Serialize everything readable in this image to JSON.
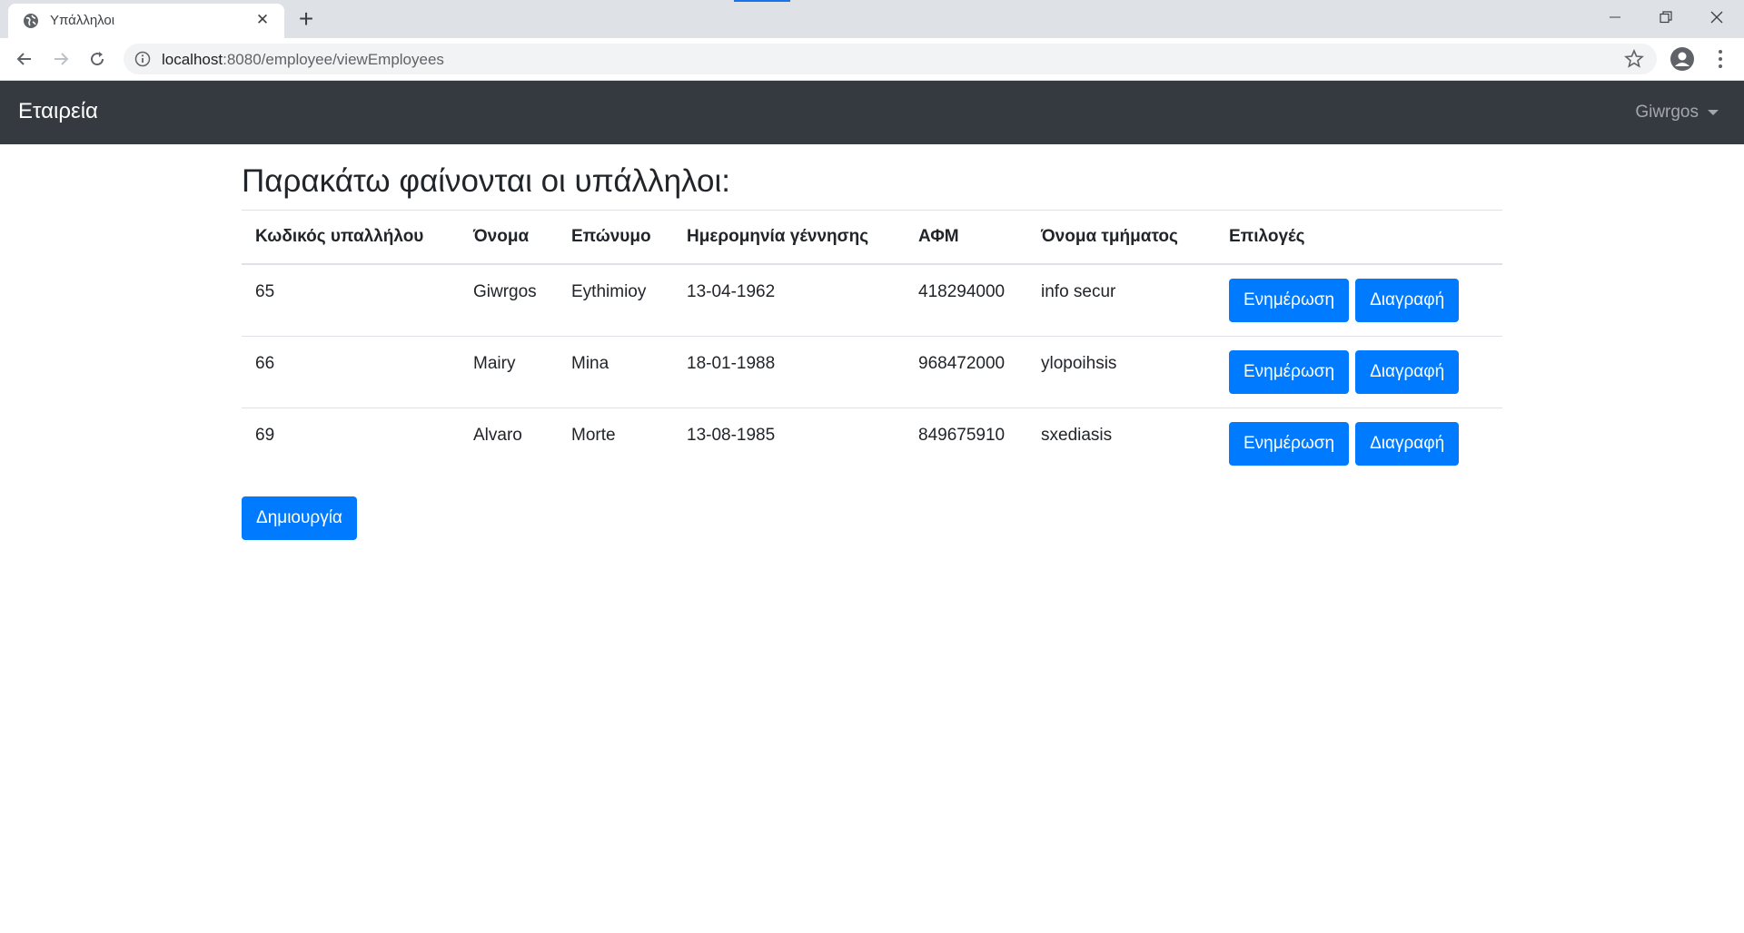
{
  "browser": {
    "tab_title": "Υπάλληλοι",
    "url_host": "localhost",
    "url_rest": ":8080/employee/viewEmployees"
  },
  "navbar": {
    "brand": "Εταιρεία",
    "user": "Giwrgos"
  },
  "page": {
    "heading": "Παρακάτω φαίνονται οι υπάλληλοι:",
    "columns": [
      "Κωδικός υπαλλήλου",
      "Όνομα",
      "Επώνυμο",
      "Ημερομηνία γέννησης",
      "ΑΦΜ",
      "Όνομα τμήματος",
      "Επιλογές"
    ],
    "rows": [
      {
        "id": "65",
        "first_name": "Giwrgos",
        "last_name": "Eythimioy",
        "birth_date": "13-04-1962",
        "afm": "418294000",
        "department": "info secur"
      },
      {
        "id": "66",
        "first_name": "Mairy",
        "last_name": "Mina",
        "birth_date": "18-01-1988",
        "afm": "968472000",
        "department": "ylopoihsis"
      },
      {
        "id": "69",
        "first_name": "Alvaro",
        "last_name": "Morte",
        "birth_date": "13-08-1985",
        "afm": "849675910",
        "department": "sxediasis"
      }
    ],
    "update_label": "Ενημέρωση",
    "delete_label": "Διαγραφή",
    "create_label": "Δημιουργία"
  },
  "colors": {
    "navbar_bg": "#343a40",
    "primary": "#007bff"
  }
}
